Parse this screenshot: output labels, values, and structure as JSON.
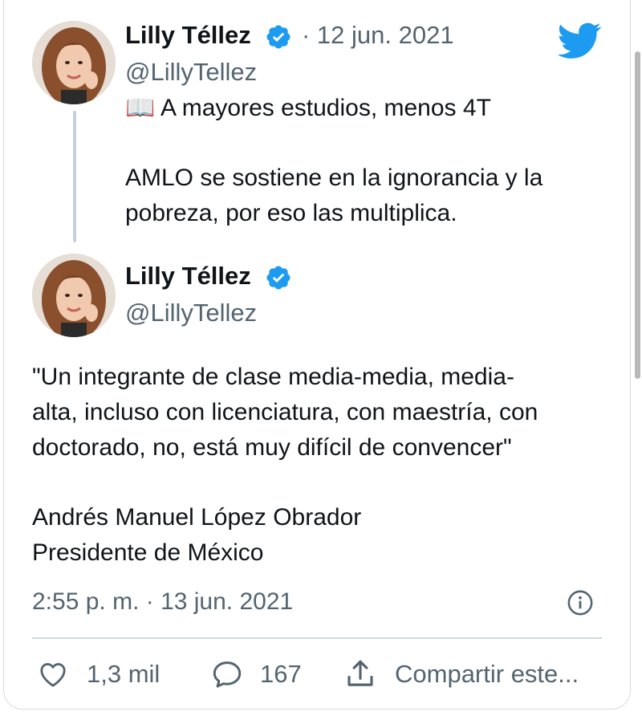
{
  "colors": {
    "verified_blue": "#1d9bf0",
    "twitter_blue": "#1d9bf0",
    "secondary_text": "#536471",
    "primary_text": "#0f1419"
  },
  "parent_tweet": {
    "author_name": "Lilly Téllez",
    "handle": "@LillyTellez",
    "date": "· 12 jun. 2021",
    "line1": "📖 A mayores estudios, menos 4T",
    "line2": "AMLO se sostiene en la ignorancia y la",
    "line3": "pobreza, por eso las multiplica."
  },
  "main_tweet": {
    "author_name": "Lilly Téllez",
    "handle": "@LillyTellez",
    "line1": "\"Un integrante de clase media-media, media-",
    "line2": "alta, incluso con licenciatura, con maestría, con",
    "line3": "doctorado, no, está muy difícil de convencer\"",
    "line4": "Andrés Manuel López Obrador",
    "line5": "Presidente de México",
    "timestamp": "2:55 p. m. · 13 jun. 2021"
  },
  "actions": {
    "likes": "1,3 mil",
    "replies": "167",
    "share": "Compartir este..."
  },
  "icons": [
    "twitter-bird-icon",
    "verified-badge-icon",
    "info-icon",
    "heart-icon",
    "reply-icon",
    "share-icon"
  ]
}
